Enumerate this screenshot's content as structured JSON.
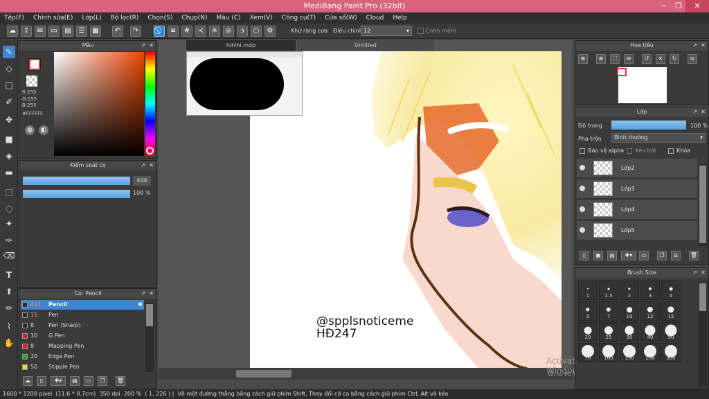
{
  "app": {
    "title": "MediBang Paint Pro (32bit)",
    "min": "−",
    "max": "❐",
    "close": "✕"
  },
  "menu": [
    "Tệp(F)",
    "Chỉnh sửa(E)",
    "Lớp(L)",
    "Bộ lọc(R)",
    "Chọn(S)",
    "Chụp(N)",
    "Màu (C)",
    "Xem(V)",
    "Công cụ(T)",
    "Cửa sổ(W)",
    "Cloud",
    "Help"
  ],
  "toolbar": {
    "antialias_label": "Khử răng cưa",
    "correction_label": "Điều chỉnh",
    "correction_value": "12",
    "smooth_label": "Canh mềm"
  },
  "color_panel": {
    "title": "Màu",
    "r": "R:255",
    "g": "G:255",
    "b": "B:255",
    "hex": "#FFFFFF"
  },
  "brush_control": {
    "title": "Kiểm soát cọ",
    "size_value": "444",
    "opacity_value": "100 %",
    "size_fill": 1.0,
    "opacity_fill": 1.0
  },
  "brush_panel": {
    "title": "Cọ: Pencil",
    "items": [
      {
        "size": "444",
        "name": "Pencil",
        "color": "#2a2a2a"
      },
      {
        "size": "15",
        "name": "Pen",
        "color": "#2a2a2a"
      },
      {
        "size": "8",
        "name": "Pen (Sharp)",
        "color": "#2a2a2a"
      },
      {
        "size": "10",
        "name": "G Pen",
        "color": "#e02020"
      },
      {
        "size": "8",
        "name": "Mapping Pen",
        "color": "#e02020"
      },
      {
        "size": "20",
        "name": "Edge Pen",
        "color": "#20b020"
      },
      {
        "size": "50",
        "name": "Stipple Pen",
        "color": "#e0e020"
      }
    ]
  },
  "tabs": {
    "doc1": "hihihi.mdp",
    "doc2": "Untitled"
  },
  "canvas": {
    "watermark_line1": "@spplsnoticeme",
    "watermark_line2": "HĐ247"
  },
  "navigator": {
    "title": "Hoa tiêu"
  },
  "layer_panel": {
    "title": "Lớp",
    "opacity_label": "Độ trong",
    "opacity_value": "100 %",
    "opacity_fill": 1.0,
    "blend_label": "Pha trộn",
    "blend_value": "Bình thường",
    "protect_alpha": "Bảo vệ alpha",
    "clipping": "Xén bớt",
    "lock": "Khóa",
    "layers": [
      "Lớp2",
      "Lớp3",
      "Lớp4",
      "Lớp5"
    ]
  },
  "brush_size": {
    "title": "Brush Size",
    "sizes": [
      "1",
      "1.5",
      "2",
      "3",
      "4",
      "5",
      "7",
      "10",
      "12",
      "15",
      "20",
      "25",
      "30",
      "40",
      "50",
      "70",
      "100",
      "150",
      "200",
      "300"
    ]
  },
  "status": {
    "size": "1600 * 1200 pixel",
    "cm": "(11.6 * 8.7cm)",
    "dpi": "350 dpi",
    "zoom": "200 %",
    "coords": "( 1, 226 )",
    "hint": "Vẽ một đường thẳng bằng cách giữ phím Shift, Thay đổi cỡ cọ bằng cách giữ phím Ctrl, Alt và kéo"
  },
  "activation": {
    "line1": "Activate Windows",
    "line2": "Go to PC settings to activate Windows."
  }
}
